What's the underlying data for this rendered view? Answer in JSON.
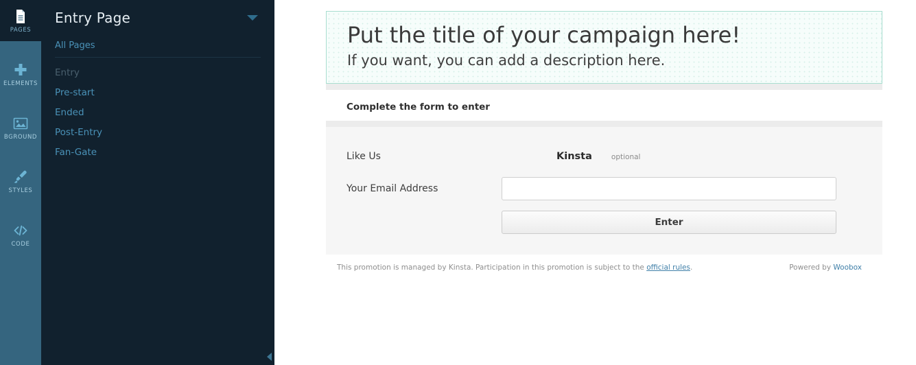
{
  "rail": {
    "items": [
      {
        "label": "PAGES",
        "icon": "document-icon",
        "active": true
      },
      {
        "label": "ELEMENTS",
        "icon": "plus-icon",
        "active": false
      },
      {
        "label": "BGROUND",
        "icon": "image-icon",
        "active": false
      },
      {
        "label": "STYLES",
        "icon": "brush-icon",
        "active": false
      },
      {
        "label": "CODE",
        "icon": "code-icon",
        "active": false
      }
    ]
  },
  "nav": {
    "title": "Entry Page",
    "caret": "chevron-down-icon",
    "all_pages_label": "All Pages",
    "pages": [
      {
        "label": "Entry",
        "current": true
      },
      {
        "label": "Pre-start",
        "current": false
      },
      {
        "label": "Ended",
        "current": false
      },
      {
        "label": "Post-Entry",
        "current": false
      },
      {
        "label": "Fan-Gate",
        "current": false
      }
    ],
    "collapse": "collapse-panel-arrow"
  },
  "preview": {
    "title": "Put the title of your campaign here!",
    "description": "If you want, you can add a description here.",
    "section_heading": "Complete the form to enter",
    "form": {
      "like_us_label": "Like Us",
      "brand_name": "Kinsta",
      "optional_tag": "optional",
      "email_label": "Your Email Address",
      "email_value": "",
      "email_placeholder": "",
      "submit_label": "Enter"
    },
    "footer": {
      "text_before": "This promotion is managed by Kinsta. Participation in this promotion is subject to the ",
      "rules_link": "official rules",
      "text_after": ".",
      "powered_prefix": "Powered by ",
      "powered_link": "Woobox"
    }
  },
  "colors": {
    "rail_bg": "#35657f",
    "nav_bg": "#11212e",
    "nav_link": "#4a92b8",
    "title_border": "#a8ded0",
    "title_bg": "#f6fdfb",
    "form_bg": "#f6f6f6",
    "link": "#3f7fa8"
  }
}
